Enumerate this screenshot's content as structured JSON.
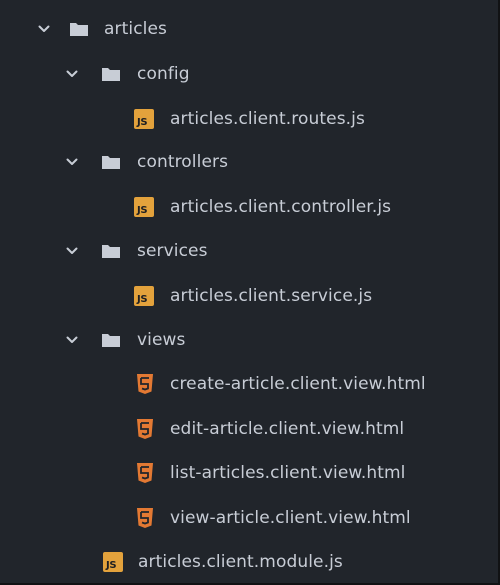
{
  "tree": {
    "root": {
      "label": "articles"
    },
    "config": {
      "label": "config",
      "file": "articles.client.routes.js"
    },
    "controllers": {
      "label": "controllers",
      "file": "articles.client.controller.js"
    },
    "services": {
      "label": "services",
      "file": "articles.client.service.js"
    },
    "views": {
      "label": "views",
      "files": [
        "create-article.client.view.html",
        "edit-article.client.view.html",
        "list-articles.client.view.html",
        "view-article.client.view.html"
      ]
    },
    "module_file": "articles.client.module.js"
  },
  "icons": {
    "folder": "folder-icon",
    "chevron": "chevron-down-icon",
    "js": "js-file-icon",
    "html5": "html5-file-icon",
    "js_text": "JS"
  },
  "colors": {
    "background": "#21252b",
    "text": "#c8cdd6",
    "folder": "#c8cdd6",
    "js_badge": "#e3a23c",
    "html5_badge": "#e37933"
  }
}
